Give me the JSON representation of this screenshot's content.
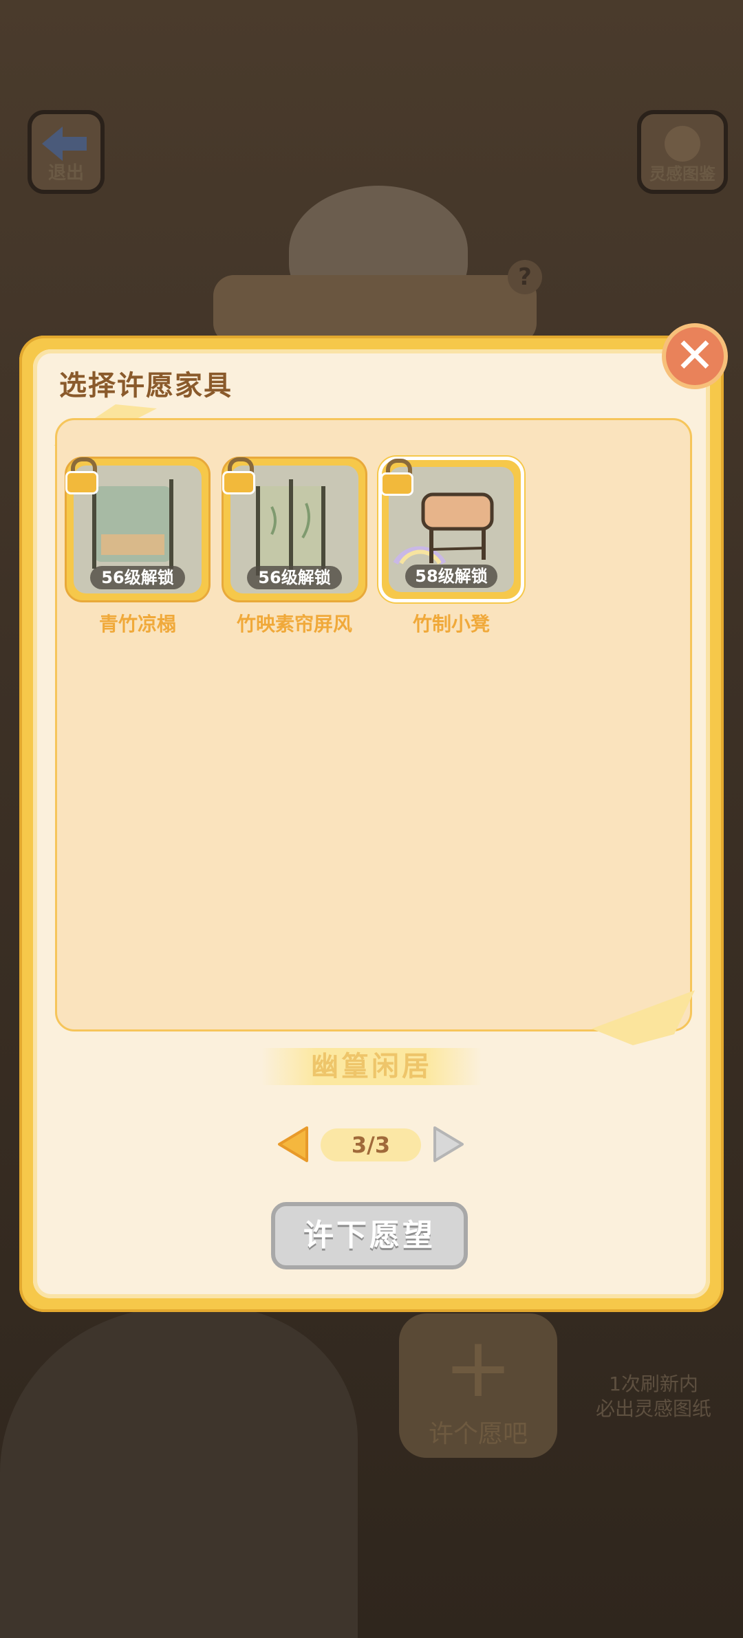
{
  "background": {
    "exit_label": "退出",
    "guide_label": "灵感图鉴",
    "help_symbol": "?",
    "wish_label": "许个愿吧",
    "wish_plus": "+",
    "note_line1": "1次刷新内",
    "note_line2": "必出灵感图纸"
  },
  "modal": {
    "title": "选择许愿家具",
    "close_symbol": "✕",
    "items": [
      {
        "name": "青竹凉榻",
        "unlock": "56级解锁"
      },
      {
        "name": "竹映素帘屏风",
        "unlock": "56级解锁"
      },
      {
        "name": "竹制小凳",
        "unlock": "58级解锁"
      }
    ],
    "set_name": "幽篁闲居",
    "page_indicator": "3/3",
    "wish_button": "许下愿望"
  },
  "colors": {
    "frame": "#f6c84a",
    "panel": "#fbf0dc",
    "title": "#8a5a2b",
    "item_name": "#f0a93a",
    "close": "#e9825a",
    "disabled_button": "#d5d5d5"
  }
}
